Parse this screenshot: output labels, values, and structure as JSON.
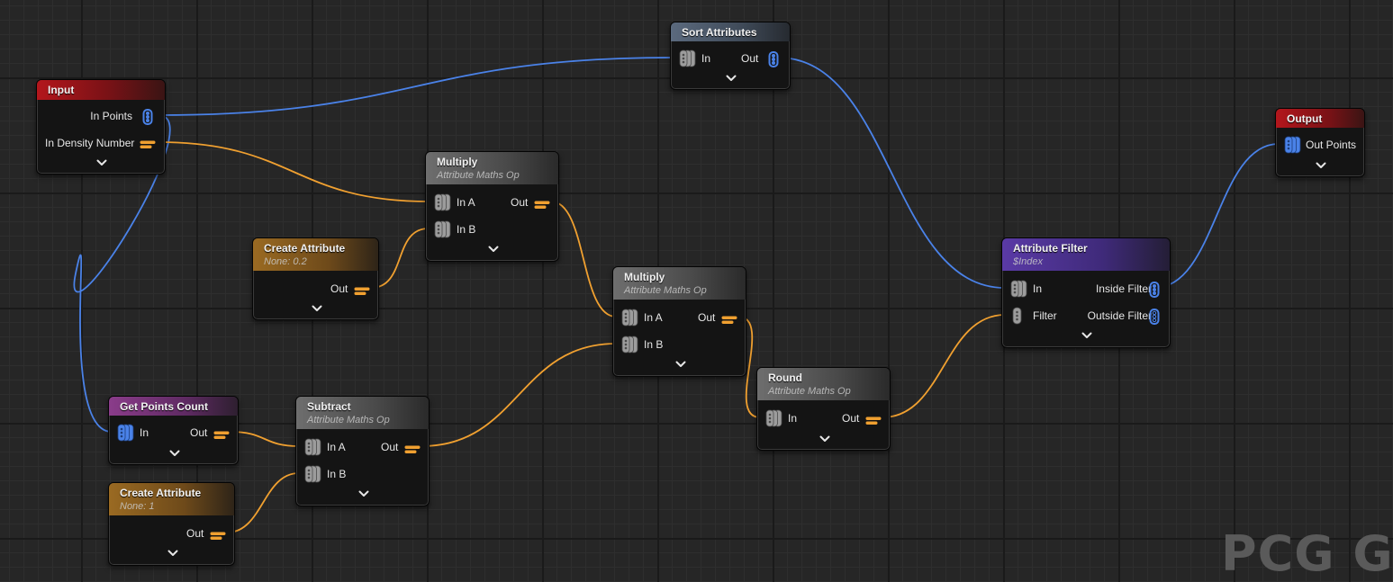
{
  "watermark": "PCG Gra",
  "colors": {
    "points_wire": "#4a82e8",
    "attribute_wire": "#f0a030",
    "input_header": "#b3161c",
    "sort_header": "#5b6a7e",
    "math_header": "#6e6e6e",
    "create_header": "#9a6a22",
    "points_count_header": "#8a3c8a",
    "filter_header": "#5a3aa6"
  },
  "nodes": {
    "input": {
      "title": "Input",
      "pins": [
        "In Points",
        "In Density Number"
      ]
    },
    "sort": {
      "title": "Sort Attributes",
      "in": "In",
      "out": "Out"
    },
    "multiply1": {
      "title": "Multiply",
      "subtitle": "Attribute Maths Op",
      "in_a": "In A",
      "in_b": "In B",
      "out": "Out"
    },
    "create1": {
      "title": "Create Attribute",
      "subtitle": "None: 0.2",
      "out": "Out"
    },
    "multiply2": {
      "title": "Multiply",
      "subtitle": "Attribute Maths Op",
      "in_a": "In A",
      "in_b": "In B",
      "out": "Out"
    },
    "round": {
      "title": "Round",
      "subtitle": "Attribute Maths Op",
      "in": "In",
      "out": "Out"
    },
    "filter": {
      "title": "Attribute Filter",
      "subtitle": "$Index",
      "in": "In",
      "filter": "Filter",
      "inside": "Inside Filter",
      "outside": "Outside Filter"
    },
    "output": {
      "title": "Output",
      "pin": "Out Points"
    },
    "count": {
      "title": "Get Points Count",
      "in": "In",
      "out": "Out"
    },
    "subtract": {
      "title": "Subtract",
      "subtitle": "Attribute Maths Op",
      "in_a": "In A",
      "in_b": "In B",
      "out": "Out"
    },
    "create2": {
      "title": "Create Attribute",
      "subtitle": "None: 1",
      "out": "Out"
    }
  },
  "wires": [
    {
      "from": "input.in_points",
      "to": "sort.in",
      "type": "points"
    },
    {
      "from": "input.in_points",
      "to": "count.in",
      "type": "points"
    },
    {
      "from": "input.in_density_number",
      "to": "multiply1.in_a",
      "type": "attribute"
    },
    {
      "from": "create1.out",
      "to": "multiply1.in_b",
      "type": "attribute"
    },
    {
      "from": "multiply1.out",
      "to": "multiply2.in_a",
      "type": "attribute"
    },
    {
      "from": "subtract.out",
      "to": "multiply2.in_b",
      "type": "attribute"
    },
    {
      "from": "multiply2.out",
      "to": "round.in",
      "type": "attribute"
    },
    {
      "from": "round.out",
      "to": "filter.filter",
      "type": "attribute"
    },
    {
      "from": "sort.out",
      "to": "filter.in",
      "type": "points"
    },
    {
      "from": "filter.inside_filter",
      "to": "output.out_points",
      "type": "points"
    },
    {
      "from": "count.out",
      "to": "subtract.in_a",
      "type": "attribute"
    },
    {
      "from": "create2.out",
      "to": "subtract.in_b",
      "type": "attribute"
    }
  ]
}
